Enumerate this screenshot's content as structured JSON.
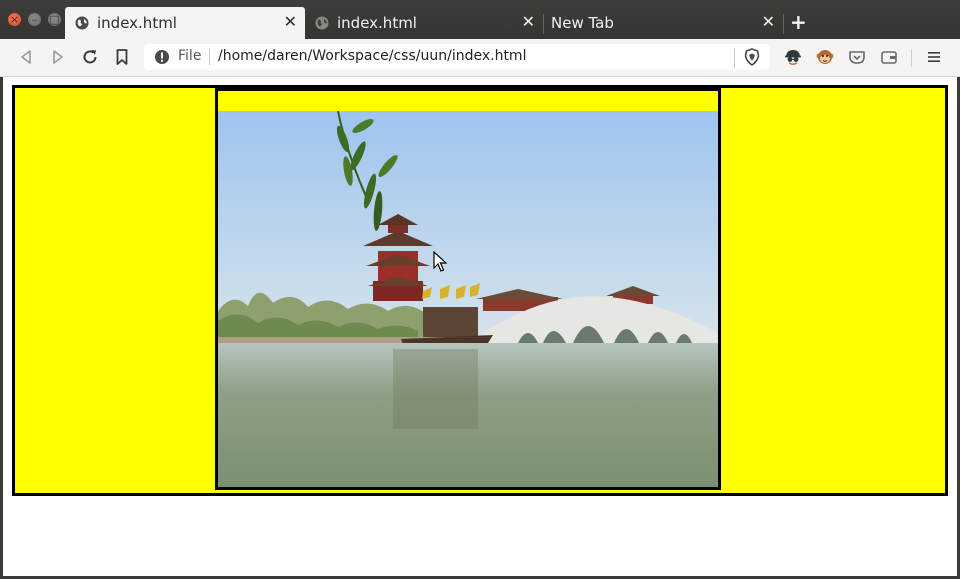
{
  "window": {
    "tabs": [
      {
        "title": "index.html",
        "active": true,
        "close_label": "✕"
      },
      {
        "title": "index.html",
        "active": false,
        "close_label": "✕"
      },
      {
        "title": "New Tab",
        "active": false,
        "close_label": "✕"
      }
    ],
    "new_tab_label": "+"
  },
  "toolbar": {
    "url_scheme_label": "File",
    "url": "/home/daren/Workspace/css/uun/index.html"
  },
  "colors": {
    "box_background": "#ffff00",
    "border": "#000000",
    "chrome": "#3b3a37",
    "toolbar": "#f5f4f2"
  },
  "icons": [
    "back-icon",
    "forward-icon",
    "reload-icon",
    "bookmark-icon",
    "info-icon",
    "brave-shield-icon",
    "extension-spy-icon",
    "extension-monkey-icon",
    "pocket-icon",
    "wallet-icon",
    "menu-icon"
  ]
}
